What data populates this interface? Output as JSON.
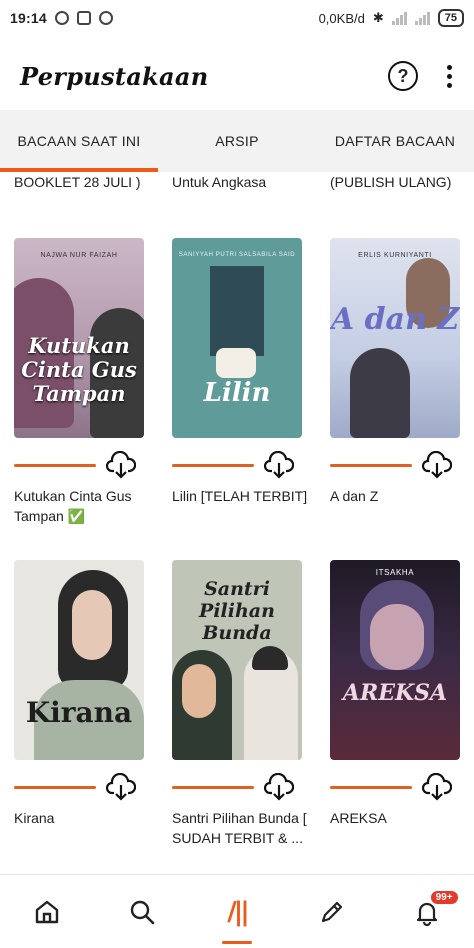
{
  "status_bar": {
    "time": "19:14",
    "network_speed": "0,0KB/d",
    "battery": "75"
  },
  "app_bar": {
    "title": "Perpustakaan",
    "help_label": "?"
  },
  "tabs": [
    {
      "label": "BACAAN SAAT INI",
      "active": true
    },
    {
      "label": "ARSIP",
      "active": false
    },
    {
      "label": "DAFTAR BACAAN",
      "active": false
    }
  ],
  "partial_titles": [
    "BOOKLET 28 JULI )",
    "Untuk Angkasa",
    "(PUBLISH ULANG)"
  ],
  "books": [
    {
      "title": "Kutukan Cinta Gus Tampan ✅",
      "cover_text": "Kutukan Cinta Gus Tampan",
      "author": "Najwa Nur Faizah",
      "cover_color": "#b8a3b4"
    },
    {
      "title": "Lilin [TELAH TERBIT]",
      "cover_text": "Lilin",
      "author": "SANIYYAH PUTRI SALSABILA SAID",
      "cover_color": "#5e9b99"
    },
    {
      "title": "A dan Z",
      "cover_text": "A dan Z",
      "author": "ERLIS KURNIYANTI",
      "cover_color": "#c9d3e6"
    },
    {
      "title": "Kirana",
      "cover_text": "Kirana",
      "author": "",
      "cover_color": "#e7e6e1"
    },
    {
      "title": "Santri Pilihan Bunda [ SUDAH TERBIT & ...",
      "cover_text": "Santri Pilihan Bunda",
      "author": "",
      "cover_color": "#bfc6b7"
    },
    {
      "title": "AREKSA",
      "cover_text": "AREKSA",
      "author": "ITSAKHA",
      "cover_color": "#2e2434"
    }
  ],
  "bottom_nav": {
    "items": [
      "home",
      "search",
      "library",
      "write",
      "notifications"
    ],
    "notification_badge": "99+"
  },
  "colors": {
    "accent": "#ee5a1a",
    "badge": "#e5392b"
  }
}
